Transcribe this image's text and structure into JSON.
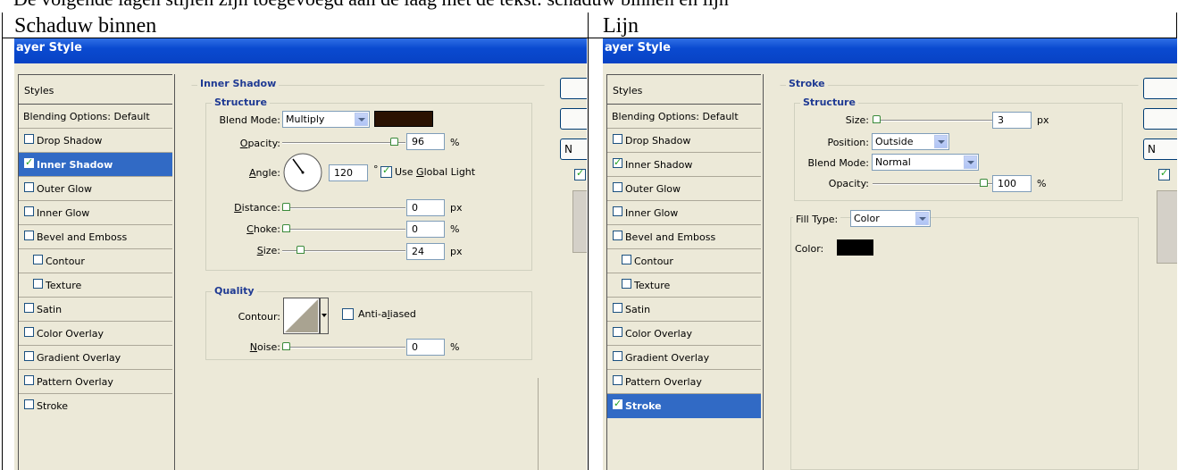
{
  "top_line_text": "De volgende lagen stijlen zijn toegevoegd aan de laag met de tekst: schaduw binnen en lijn",
  "left_cell_title": "Schaduw binnen",
  "right_cell_title": "Lijn",
  "dialog_title": "ayer Style",
  "styles_header": "Styles",
  "blending_options": "Blending Options: Default",
  "style_items": [
    "Drop Shadow",
    "Inner Shadow",
    "Outer Glow",
    "Inner Glow",
    "Bevel and Emboss",
    "Contour",
    "Texture",
    "Satin",
    "Color Overlay",
    "Gradient Overlay",
    "Pattern Overlay",
    "Stroke"
  ],
  "left": {
    "section_title": "Inner Shadow",
    "structure_title": "Structure",
    "blend_mode_label": "Blend Mode:",
    "blend_mode_value": "Multiply",
    "blend_color": "#2a1202",
    "opacity_label": "Opacity:",
    "opacity_value": "96",
    "percent": "%",
    "angle_label": "Angle:",
    "angle_value": "120",
    "degree": "°",
    "global_light_label": "Use Global Light",
    "distance_label": "Distance:",
    "distance_value": "0",
    "choke_label": "Choke:",
    "choke_value": "0",
    "size_label": "Size:",
    "size_value": "24",
    "px": "px",
    "quality_title": "Quality",
    "contour_label": "Contour:",
    "anti_aliased_label": "Anti-aliased",
    "noise_label": "Noise:",
    "noise_value": "0",
    "side_btn_n": "N"
  },
  "right": {
    "section_title": "Stroke",
    "structure_title": "Structure",
    "size_label": "Size:",
    "size_value": "3",
    "px": "px",
    "position_label": "Position:",
    "position_value": "Outside",
    "blend_mode_label": "Blend Mode:",
    "blend_mode_value": "Normal",
    "opacity_label": "Opacity:",
    "opacity_value": "100",
    "percent": "%",
    "fill_type_label": "Fill Type:",
    "fill_type_value": "Color",
    "color_label": "Color:",
    "stroke_color": "#000000",
    "side_btn_n": "N"
  }
}
